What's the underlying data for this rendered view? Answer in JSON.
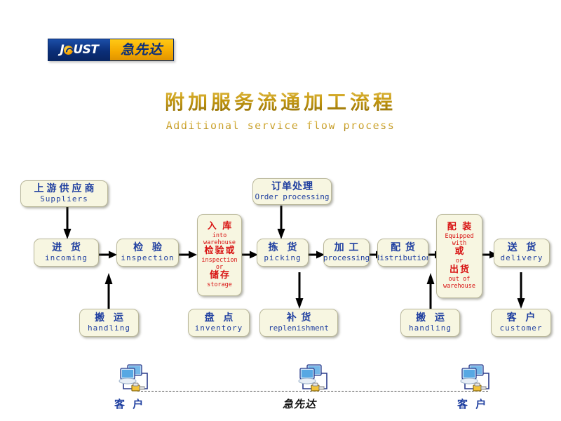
{
  "logo": {
    "left_text_a": "J",
    "left_icon": "swirl-o-icon",
    "left_text_b": "UST",
    "right_text": "急先达"
  },
  "title": {
    "cn": "附加服务流通加工流程",
    "en": "Additional service flow process"
  },
  "colors": {
    "title_gold": "#c8a218",
    "node_fill": "#f7f6e1",
    "node_text_blue": "#1f3fa0",
    "node_text_red": "#d81111",
    "logo_blue": "#0b2f79",
    "logo_yellow": "#f4a900"
  },
  "flow": {
    "nodes": [
      {
        "id": "suppliers",
        "cn": "上游供应商",
        "en": "Suppliers",
        "color": "blue"
      },
      {
        "id": "order",
        "cn": "订单处理",
        "en": "Order processing",
        "color": "blue"
      },
      {
        "id": "incoming",
        "cn": "进 货",
        "en": "incoming",
        "color": "blue"
      },
      {
        "id": "inspection",
        "cn": "检 验",
        "en": "inspection",
        "color": "blue"
      },
      {
        "id": "picking",
        "cn": "拣 货",
        "en": "picking",
        "color": "blue"
      },
      {
        "id": "processing",
        "cn": "加 工",
        "en": "processing",
        "color": "blue"
      },
      {
        "id": "distribution",
        "cn": "配 货",
        "en": "distribution",
        "color": "blue"
      },
      {
        "id": "delivery",
        "cn": "送 货",
        "en": "delivery",
        "color": "blue"
      },
      {
        "id": "handling-left",
        "cn": "搬 运",
        "en": "handling",
        "color": "blue"
      },
      {
        "id": "inventory",
        "cn": "盘 点",
        "en": "inventory",
        "color": "blue"
      },
      {
        "id": "replenishment",
        "cn": "补 货",
        "en": "replenishment",
        "color": "blue"
      },
      {
        "id": "handling-right",
        "cn": "搬 运",
        "en": "handling",
        "color": "blue"
      },
      {
        "id": "customer",
        "cn": "客 户",
        "en": "customer",
        "color": "blue"
      }
    ],
    "warehouse_node": {
      "id": "into-warehouse",
      "color": "red",
      "lines": [
        {
          "cn": "入 库",
          "en": "into warehouse"
        },
        {
          "cn": "检验或",
          "en": "inspection or"
        },
        {
          "cn": "储存",
          "en": "storage"
        }
      ]
    },
    "equip_node": {
      "id": "equipped-or-out",
      "color": "red",
      "lines": [
        {
          "cn": "配 装",
          "en": "Equipped with"
        },
        {
          "cn": "或",
          "en": "or"
        },
        {
          "cn": "出货",
          "en": "out of warehouse"
        }
      ]
    }
  },
  "network": {
    "items": [
      {
        "id": "net-customer-left",
        "label": "客 户",
        "style": "blue",
        "icon": "computers-icon"
      },
      {
        "id": "net-joust",
        "label": "急先达",
        "style": "black",
        "icon": "computers-icon"
      },
      {
        "id": "net-customer-right",
        "label": "客 户",
        "style": "blue",
        "icon": "computers-icon"
      }
    ]
  }
}
